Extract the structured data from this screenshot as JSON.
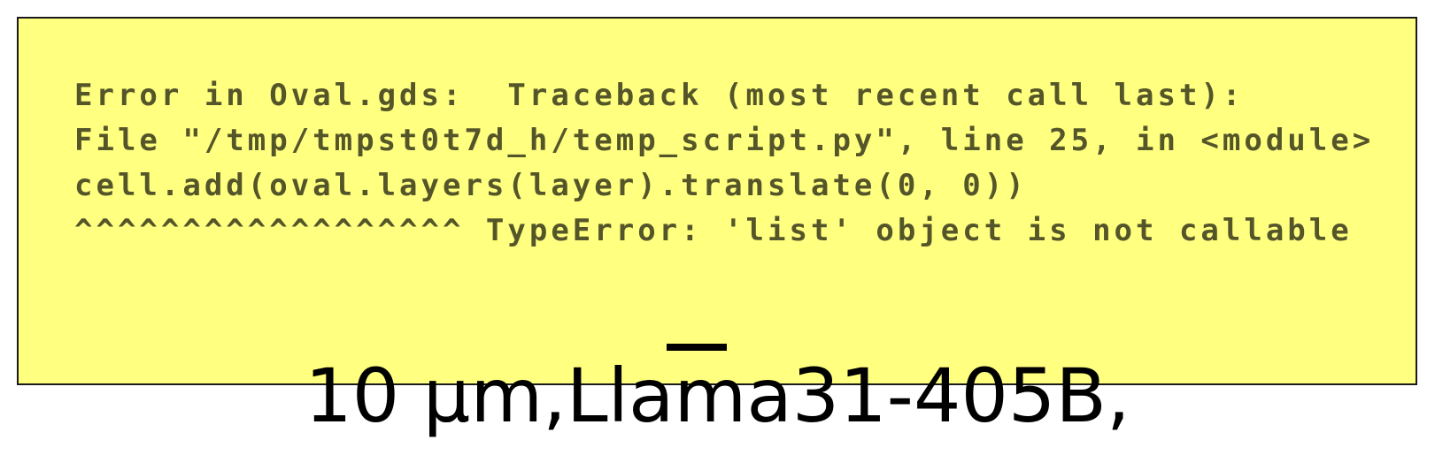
{
  "error_box": {
    "background": "#ffff80",
    "text_color": "#55552a",
    "message": "Error in Oval.gds:  Traceback (most recent call last):   File \"/tmp/tmpst0t7d_h/temp_script.py\", line 25, in <module> cell.add(oval.layers(layer).translate(0, 0)) ^^^^^^^^^^^^^^^^^^ TypeError: 'list' object is not callable"
  },
  "caption": {
    "text": "10 µm,Llama31-405B,"
  }
}
